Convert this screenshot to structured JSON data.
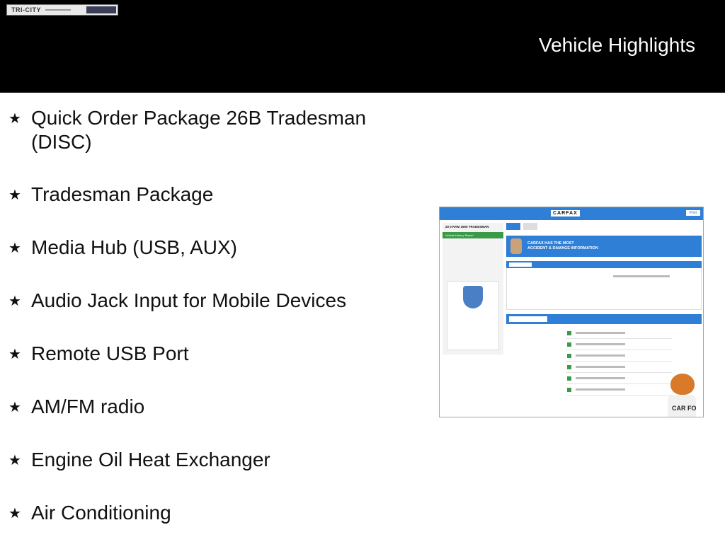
{
  "header": {
    "logo_text": "TRI-CITY",
    "title": "Vehicle Highlights"
  },
  "highlights": [
    "Quick Order Package 26B Tradesman (DISC)",
    "Tradesman Package",
    "Media Hub (USB, AUX)",
    "Audio Jack Input for Mobile Devices",
    "Remote USB Port",
    "AM/FM radio",
    "Engine Oil Heat Exchanger",
    "Air Conditioning"
  ],
  "carfax": {
    "logo": "CARFAX",
    "print_label": "Print",
    "vehicle_title": "20 0 RAM 1500 TRADESMAN",
    "nav_item": "Vehicle History Report",
    "banner_line1": "CARFAX HAS THE MOST",
    "banner_line2": "ACCIDENT & DAMAGE INFORMATION",
    "fox_text": "CAR FO"
  },
  "colors": {
    "header_bg": "#000000",
    "carfax_blue": "#2f7fd6",
    "carfax_green": "#3a9a48"
  }
}
